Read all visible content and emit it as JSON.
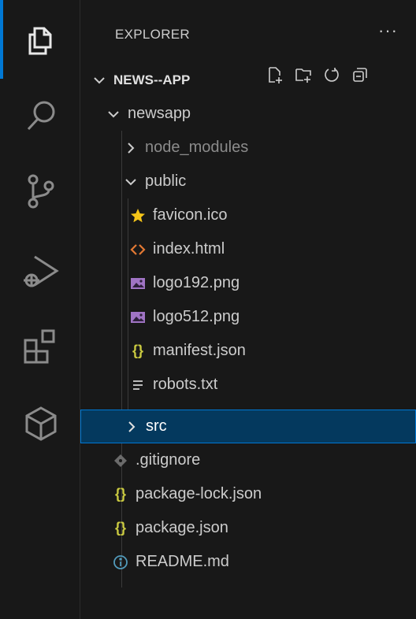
{
  "activity_bar": {
    "icons": [
      "explorer-icon",
      "search-icon",
      "source-control-icon",
      "run-debug-icon",
      "extensions-icon",
      "remote-explorer-icon"
    ],
    "accent": "#0078d4"
  },
  "explorer": {
    "title": "EXPLORER",
    "more": "···",
    "root": "NEWS--APP",
    "toolbar": [
      "new-file-icon",
      "new-folder-icon",
      "refresh-icon",
      "collapse-all-icon"
    ]
  },
  "tree": {
    "newsapp": "newsapp",
    "node_modules": "node_modules",
    "public": "public",
    "favicon": "favicon.ico",
    "index_html": "index.html",
    "logo192": "logo192.png",
    "logo512": "logo512.png",
    "manifest": "manifest.json",
    "robots": "robots.txt",
    "src": "src",
    "gitignore": ".gitignore",
    "package_lock": "package-lock.json",
    "package_json": "package.json",
    "readme": "README.md"
  },
  "colors": {
    "selected_bg": "#04395e",
    "json_icon": "#cbcb41",
    "html_icon": "#e37933",
    "image_icon": "#a074c4",
    "favicon_icon": "#f5c518",
    "info_icon": "#519aba"
  }
}
